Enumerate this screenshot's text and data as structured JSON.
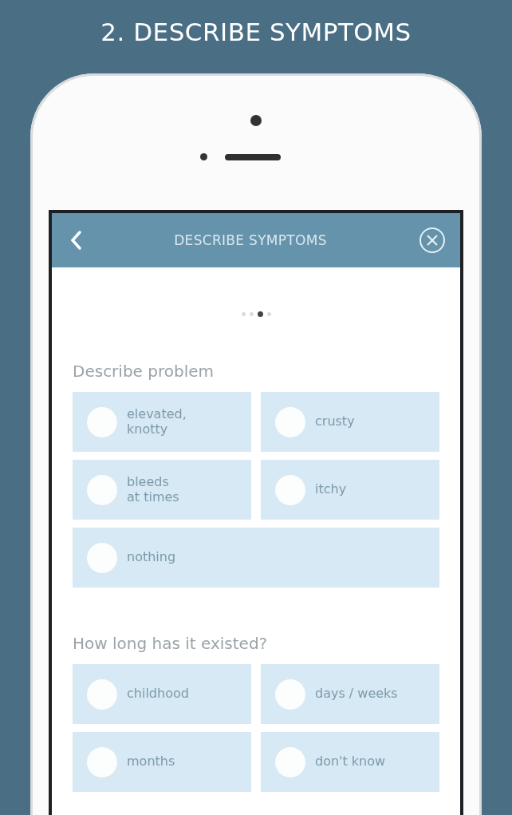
{
  "banner": {
    "title": "2. DESCRIBE SYMPTOMS"
  },
  "app_bar": {
    "title": "DESCRIBE SYMPTOMS"
  },
  "pager": [
    {
      "selected": false
    },
    {
      "selected": false
    },
    {
      "selected": true
    },
    {
      "selected": false
    }
  ],
  "sections": [
    {
      "label": "Describe problem",
      "options": [
        {
          "label": "elevated,\nknotty",
          "selected": false
        },
        {
          "label": "crusty",
          "selected": false
        },
        {
          "label": "bleeds\nat times",
          "selected": false
        },
        {
          "label": "itchy",
          "selected": false
        },
        {
          "label": "nothing",
          "selected": false
        }
      ]
    },
    {
      "label": "How long has it existed?",
      "options": [
        {
          "label": "childhood",
          "selected": false
        },
        {
          "label": "days / weeks",
          "selected": false
        },
        {
          "label": "months",
          "selected": false
        },
        {
          "label": "don't know",
          "selected": false
        }
      ]
    }
  ]
}
